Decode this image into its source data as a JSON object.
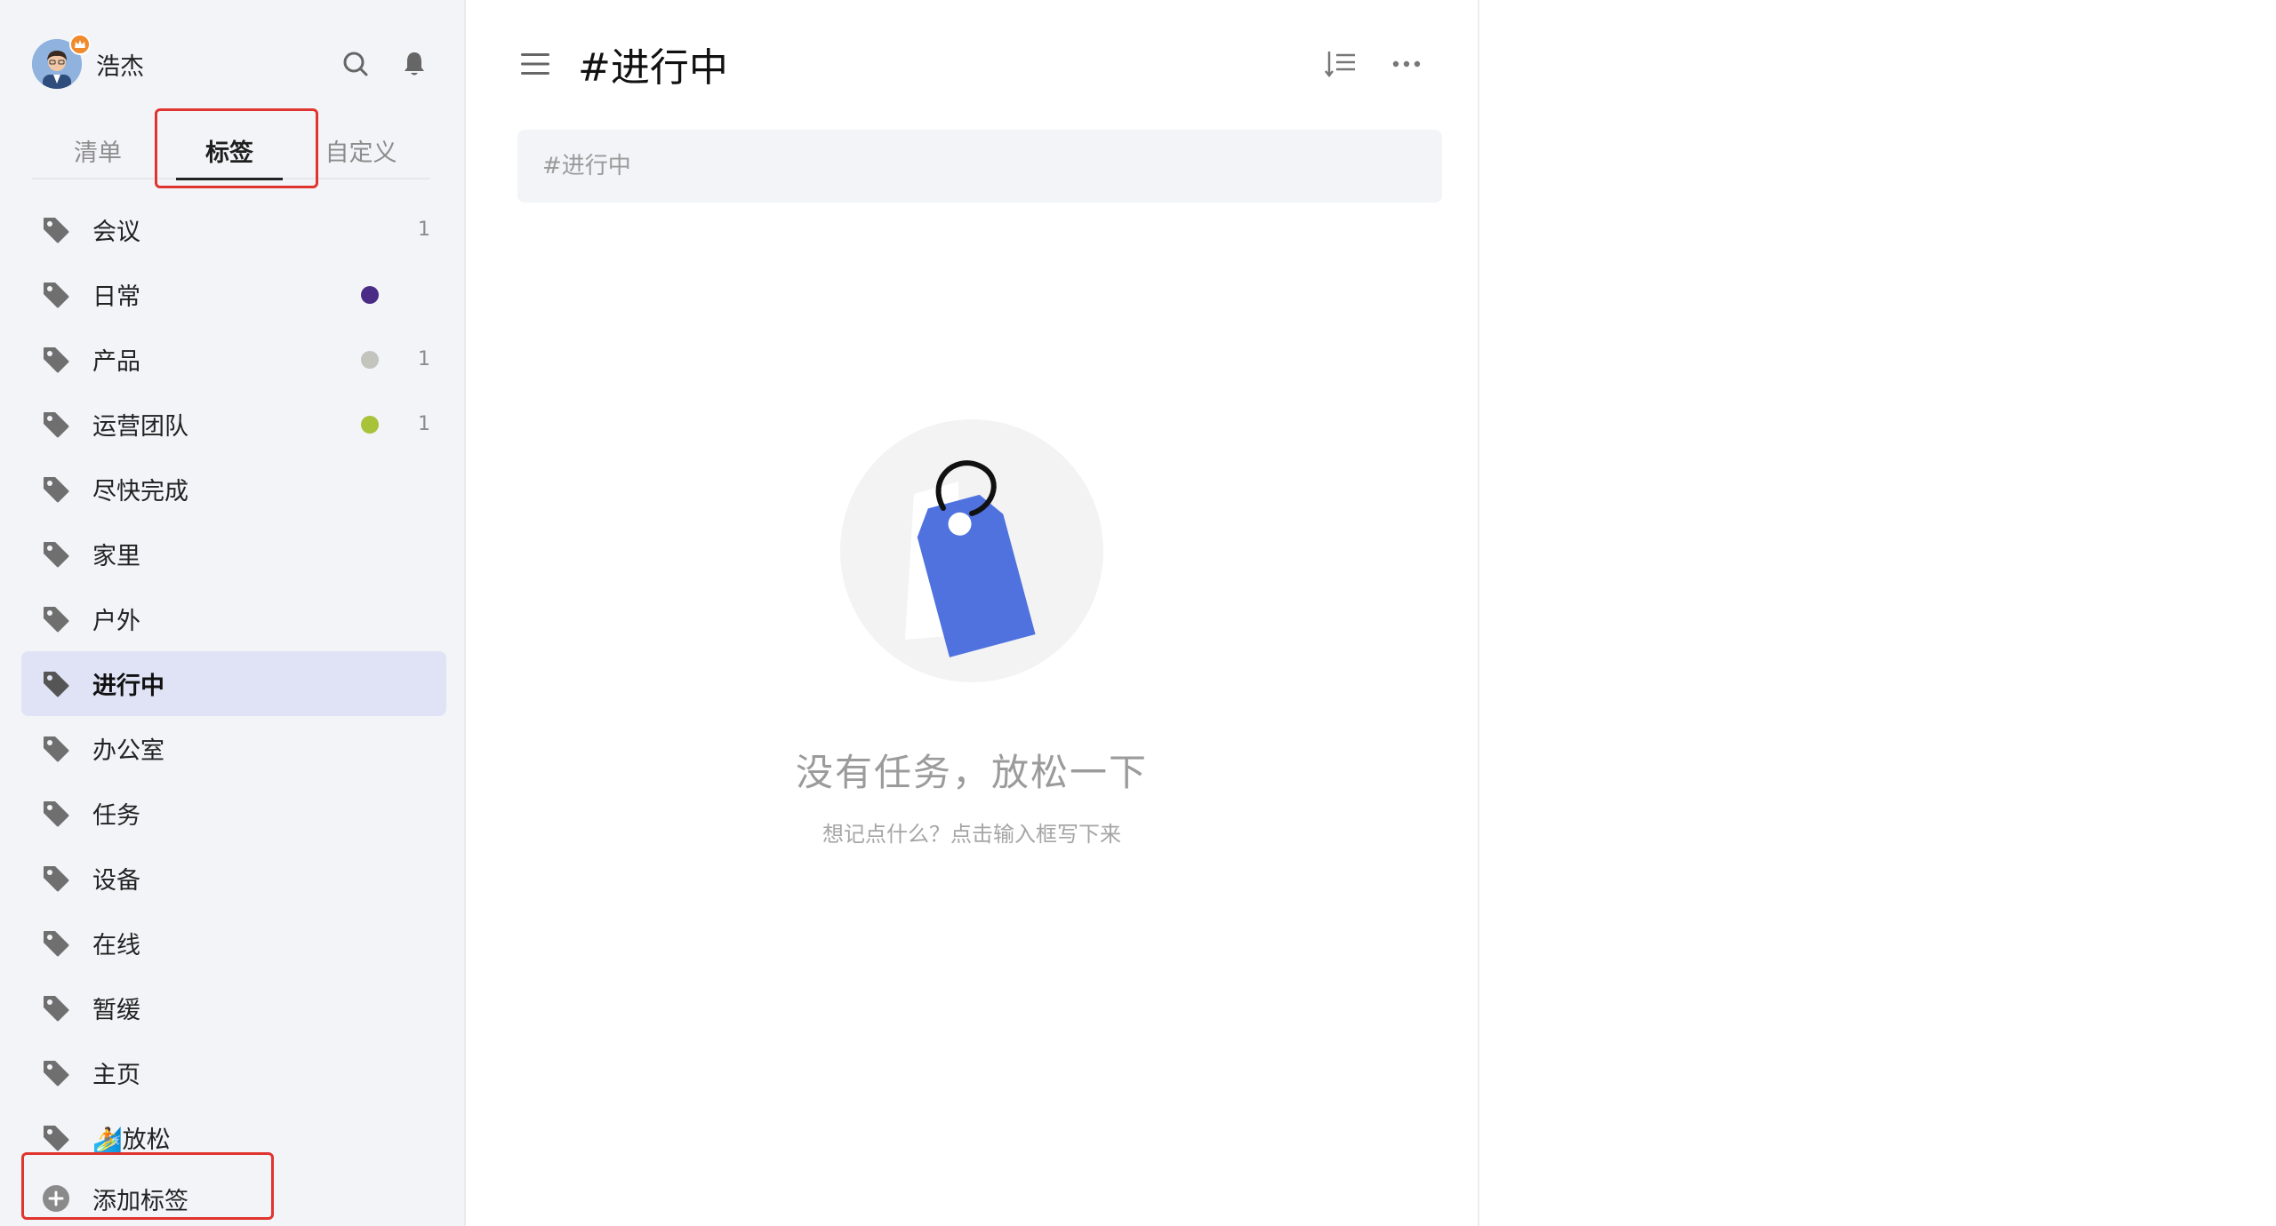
{
  "user": {
    "name": "浩杰"
  },
  "tabs": [
    {
      "label": "清单",
      "active": false
    },
    {
      "label": "标签",
      "active": true
    },
    {
      "label": "自定义",
      "active": false
    }
  ],
  "tags": [
    {
      "label": "会议",
      "dot": null,
      "count": "1"
    },
    {
      "label": "日常",
      "dot": "#4a2c86",
      "count": ""
    },
    {
      "label": "产品",
      "dot": "#c3c4bd",
      "count": "1"
    },
    {
      "label": "运营团队",
      "dot": "#a8c23a",
      "count": "1"
    },
    {
      "label": "尽快完成",
      "dot": null,
      "count": ""
    },
    {
      "label": "家里",
      "dot": null,
      "count": ""
    },
    {
      "label": "户外",
      "dot": null,
      "count": ""
    },
    {
      "label": "进行中",
      "dot": null,
      "count": "",
      "selected": true
    },
    {
      "label": "办公室",
      "dot": null,
      "count": ""
    },
    {
      "label": "任务",
      "dot": null,
      "count": ""
    },
    {
      "label": "设备",
      "dot": null,
      "count": ""
    },
    {
      "label": "在线",
      "dot": null,
      "count": ""
    },
    {
      "label": "暂缓",
      "dot": null,
      "count": ""
    },
    {
      "label": "主页",
      "dot": null,
      "count": ""
    },
    {
      "label": "🏄放松",
      "dot": null,
      "count": ""
    }
  ],
  "add_tag": {
    "label": "添加标签"
  },
  "main": {
    "title": "#进行中",
    "quick_add_placeholder": "#进行中",
    "empty_title": "没有任务，放松一下",
    "empty_subtitle": "想记点什么？点击输入框写下来"
  },
  "colors": {
    "accent": "#4f72de",
    "annotation": "#e0342e",
    "selected_bg": "#dfe3f5"
  }
}
